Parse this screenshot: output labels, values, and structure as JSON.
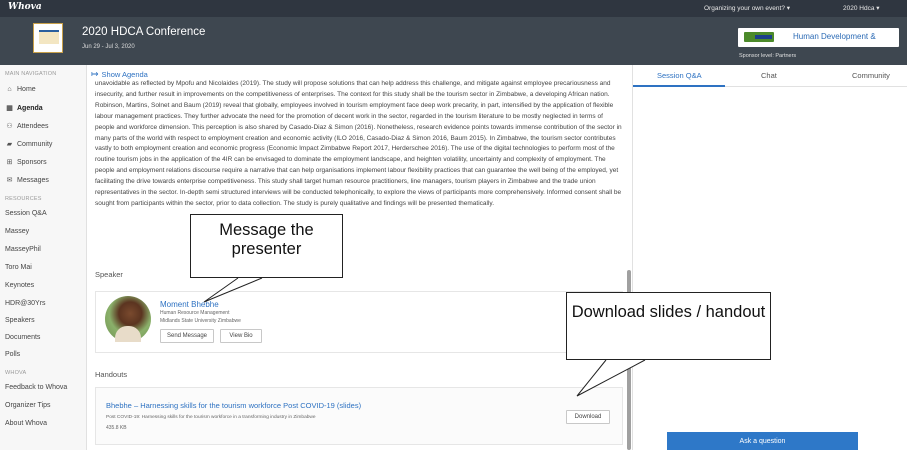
{
  "topbar": {
    "brand": "Whova",
    "organizing_link": "Organizing your own event? ▾",
    "user_menu": "2020 Hdca ▾"
  },
  "event": {
    "title": "2020 HDCA Conference",
    "dates": "Jun 29 - Jul 3, 2020",
    "sponsor_name": "Human Development &",
    "sponsor_caption": "Sponsor level: Partners"
  },
  "sidebar": {
    "main_nav_label": "MAIN NAVIGATION",
    "main_items": [
      {
        "label": "Home",
        "icon": "home-icon"
      },
      {
        "label": "Agenda",
        "icon": "calendar-icon"
      },
      {
        "label": "Attendees",
        "icon": "people-icon"
      },
      {
        "label": "Community",
        "icon": "chat-icon"
      },
      {
        "label": "Sponsors",
        "icon": "sponsor-icon"
      },
      {
        "label": "Messages",
        "icon": "envelope-icon"
      }
    ],
    "resources_label": "RESOURCES",
    "resource_items": [
      "Session Q&A",
      "Massey",
      "MasseyPhil",
      "Toro Mai",
      "Keynotes",
      "HDR@30Yrs",
      "Speakers",
      "Documents",
      "Polls"
    ],
    "whova_label": "WHOVA",
    "whova_items": [
      "Feedback to Whova",
      "Organizer Tips",
      "About Whova"
    ]
  },
  "main": {
    "show_agenda": "Show Agenda",
    "abstract": "unavoidable as reflected by Mpofu and Nicolaides (2019). The study will propose solutions that can help address this challenge, and mitigate against employee precariousness and insecurity, and further result in improvements on the competitiveness of enterprises. The context for this study shall be the tourism sector in Zimbabwe, a developing African nation. Robinson, Martins, Solnet and Baum (2019) reveal that globally, employees involved in tourism employment face deep work precarity, in part, intensified by the application of flexible labour management practices. They further advocate the need for the promotion of decent work in the sector, regarded in the tourism literature to be mostly neglected in terms of people and workforce dimension. This perception is also shared by Casado-Diaz & Simon (2016). Nonetheless, research evidence points towards immense contribution of the sector in many parts of the world with respect to employment creation and economic activity (ILO 2016, Casado-Diaz & Simon 2016, Baum 2015). In Zimbabwe, the tourism sector contributes vastly to both employment creation and economic progress (Economic Impact Zimbabwe Report 2017, Herderschee 2016). The use of the digital technologies to perform most of the routine tourism jobs in the application of the 4IR can be envisaged to dominate the employment landscape, and heighten volatility, uncertainty and complexity of employment. The people and employment relations discourse require a narrative that can help organisations implement labour flexibility practices that can guarantee the well being of the employed, yet facilitating the drive towards enterprise competitiveness. This study shall target human resource practitioners, line managers, tourism players in Zimbabwe and the trade union representatives in the sector. In-depth semi structured interviews will be conducted telephonically, to explore the views of participants more comprehensively. Informed consent shall be sought from participants within the sector, prior to data collection. The study is purely qualitative and findings will be presented thematically.",
    "speaker_heading": "Speaker",
    "speaker": {
      "name": "Moment Bhebhe",
      "role": "Human Resource Management",
      "org": "Midlands State University Zimbabwe",
      "send_message": "Send Message",
      "view_bio": "View Bio"
    },
    "handouts_heading": "Handouts",
    "handout": {
      "title": "Bhebhe – Harnessing skills for the tourism workforce Post COVID-19 (slides)",
      "description": "Post COVID-19: Harnessing skills for the tourism workforce in a transforming industry in Zimbabwe",
      "size": "435.8 KB",
      "download": "Download"
    }
  },
  "right_panel": {
    "tabs": [
      "Session Q&A",
      "Chat",
      "Community"
    ],
    "ask_button": "Ask a question"
  },
  "annotations": {
    "message_callout": "Message the presenter",
    "download_callout": "Download slides / handout"
  },
  "colors": {
    "accent": "#2e72c2",
    "topbar": "#2f3640",
    "header": "#3e4750"
  }
}
